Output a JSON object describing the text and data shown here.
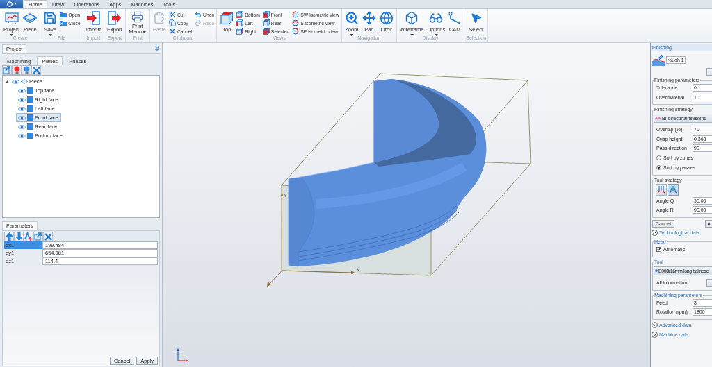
{
  "ribbon": {
    "tabs": [
      {
        "label": "Home",
        "selected": true
      },
      {
        "label": "Draw",
        "selected": false
      },
      {
        "label": "Operations",
        "selected": false
      },
      {
        "label": "Apps",
        "selected": false
      },
      {
        "label": "Machines",
        "selected": false
      },
      {
        "label": "Tools",
        "selected": false
      }
    ],
    "groups": [
      {
        "label": "Create",
        "buttons": [
          {
            "label": "Project",
            "kind": "large",
            "dropdown": true,
            "disabled": false
          },
          {
            "label": "Piece",
            "kind": "large",
            "dropdown": false,
            "disabled": false
          }
        ]
      },
      {
        "label": "File",
        "buttons": [
          {
            "label": "Save",
            "kind": "large",
            "dropdown": true,
            "disabled": false
          },
          {
            "label": "Open",
            "kind": "small",
            "dropdown": false,
            "disabled": false
          },
          {
            "label": "Close",
            "kind": "small",
            "dropdown": false,
            "disabled": false
          }
        ]
      },
      {
        "label": "Import",
        "buttons": [
          {
            "label": "Import",
            "kind": "large",
            "dropdown": false,
            "disabled": false
          }
        ]
      },
      {
        "label": "Export",
        "buttons": [
          {
            "label": "Export",
            "kind": "large",
            "dropdown": false,
            "disabled": false
          }
        ]
      },
      {
        "label": "Print",
        "buttons": [
          {
            "label": "Print Menu",
            "kind": "large",
            "dropdown": true,
            "disabled": false
          }
        ]
      },
      {
        "label": "Clipboard",
        "buttons": [
          {
            "label": "Paste",
            "kind": "large",
            "dropdown": false,
            "disabled": true
          },
          {
            "label": "Cut",
            "kind": "small",
            "dropdown": false,
            "disabled": false
          },
          {
            "label": "Copy",
            "kind": "small",
            "dropdown": false,
            "disabled": false
          },
          {
            "label": "Cancel",
            "kind": "small",
            "dropdown": false,
            "disabled": false
          },
          {
            "label": "Undo",
            "kind": "small",
            "dropdown": false,
            "disabled": false
          },
          {
            "label": "Redo",
            "kind": "small",
            "dropdown": false,
            "disabled": true
          }
        ]
      },
      {
        "label": "Views",
        "buttons": [
          {
            "label": "Top",
            "kind": "large",
            "dropdown": false,
            "disabled": false
          },
          {
            "label": "Bottom",
            "kind": "small",
            "dropdown": false,
            "disabled": false
          },
          {
            "label": "Left",
            "kind": "small",
            "dropdown": false,
            "disabled": false
          },
          {
            "label": "Right",
            "kind": "small",
            "dropdown": false,
            "disabled": false
          },
          {
            "label": "Front",
            "kind": "small",
            "dropdown": false,
            "disabled": false
          },
          {
            "label": "Rear",
            "kind": "small",
            "dropdown": false,
            "disabled": false
          },
          {
            "label": "Selected",
            "kind": "small",
            "dropdown": false,
            "disabled": false
          },
          {
            "label": "SW isometric view",
            "kind": "small",
            "dropdown": false,
            "disabled": false
          },
          {
            "label": "S isometric view",
            "kind": "small",
            "dropdown": false,
            "disabled": false
          },
          {
            "label": "SE isometric view",
            "kind": "small",
            "dropdown": false,
            "disabled": false
          }
        ]
      },
      {
        "label": "Navigation",
        "buttons": [
          {
            "label": "Zoom",
            "kind": "large",
            "dropdown": true,
            "disabled": false
          },
          {
            "label": "Pan",
            "kind": "large",
            "dropdown": false,
            "disabled": false
          },
          {
            "label": "Orbit",
            "kind": "large",
            "dropdown": false,
            "disabled": false
          }
        ]
      },
      {
        "label": "Display",
        "buttons": [
          {
            "label": "Wireframe",
            "kind": "large",
            "dropdown": true,
            "disabled": false
          },
          {
            "label": "Options",
            "kind": "large",
            "dropdown": true,
            "disabled": false
          },
          {
            "label": "CAM",
            "kind": "large",
            "dropdown": false,
            "disabled": false
          }
        ]
      },
      {
        "label": "Selection",
        "buttons": [
          {
            "label": "Select",
            "kind": "large",
            "dropdown": false,
            "disabled": false
          }
        ]
      }
    ]
  },
  "project_panel": {
    "tab": "Project",
    "subtabs": [
      {
        "label": "Machining",
        "selected": false
      },
      {
        "label": "Planes",
        "selected": true
      },
      {
        "label": "Phases",
        "selected": false
      }
    ],
    "tree": {
      "label": "Piece",
      "expanded": true,
      "selected": false,
      "children": [
        {
          "label": "Top face",
          "selected": false
        },
        {
          "label": "Right face",
          "selected": false
        },
        {
          "label": "Left face",
          "selected": false
        },
        {
          "label": "Front face",
          "selected": true
        },
        {
          "label": "Rear face",
          "selected": false
        },
        {
          "label": "Bottom face",
          "selected": false
        }
      ]
    }
  },
  "parameters_panel": {
    "tab": "Parameters",
    "rows": [
      {
        "name": "dx1",
        "value": "199.484",
        "selected": true
      },
      {
        "name": "dy1",
        "value": "654.081",
        "selected": false
      },
      {
        "name": "dz1",
        "value": "114.4",
        "selected": false
      }
    ],
    "buttons": [
      "Cancel",
      "Apply"
    ]
  },
  "viewport": {
    "axis_labels": {
      "x": "X",
      "y": "Y"
    }
  },
  "finishing_panel": {
    "title": "Finishing",
    "name_field": {
      "value": "rough 1"
    },
    "groups": [
      {
        "legend": "Finishing parameters",
        "rows": [
          {
            "kind": "field",
            "label": "Tolerance",
            "value": "0.1"
          },
          {
            "kind": "field",
            "label": "Overmaterial",
            "value": "10"
          }
        ]
      },
      {
        "legend": "Finishing strategy",
        "rows": [
          {
            "kind": "dropdown",
            "value": "Bi-directinal finishing"
          },
          {
            "kind": "field",
            "label": "Overlap (%)",
            "value": "70"
          },
          {
            "kind": "field",
            "label": "Cusp height",
            "value": "0.368"
          },
          {
            "kind": "field",
            "label": "Pass direction",
            "value": "90"
          },
          {
            "kind": "radio",
            "label": "Sort by zones",
            "selected": false
          },
          {
            "kind": "radio",
            "label": "Sort by passes",
            "selected": true
          }
        ]
      },
      {
        "legend": "Tool strategy",
        "rows": [
          {
            "kind": "icon_buttons",
            "buttons": [
              {
                "selected": false
              },
              {
                "selected": true
              }
            ]
          },
          {
            "kind": "field",
            "label": "Angle Q",
            "value": "90.00"
          },
          {
            "kind": "field",
            "label": "Angle R",
            "value": "90.00"
          }
        ]
      }
    ],
    "buttons": [
      "Cancel",
      "A"
    ],
    "sections": [
      {
        "title": "Technological data",
        "expanded": true,
        "groups": [
          {
            "legend": "Head",
            "rows": [
              {
                "kind": "checkbox",
                "label": "Automatic",
                "checked": true
              }
            ]
          },
          {
            "legend": "Tool",
            "rows": [
              {
                "kind": "dropdown",
                "value": "E008(16mm long ballnose"
              },
              {
                "kind": "info",
                "label": "All information"
              }
            ]
          },
          {
            "legend": "Machining parameters",
            "rows": [
              {
                "kind": "field",
                "label": "Feed",
                "value": "8"
              },
              {
                "kind": "field",
                "label": "Rotation (rpm)",
                "value": "1800"
              }
            ]
          }
        ]
      },
      {
        "title": "Advanced data",
        "expanded": false
      },
      {
        "title": "Machine data",
        "expanded": false
      }
    ]
  }
}
